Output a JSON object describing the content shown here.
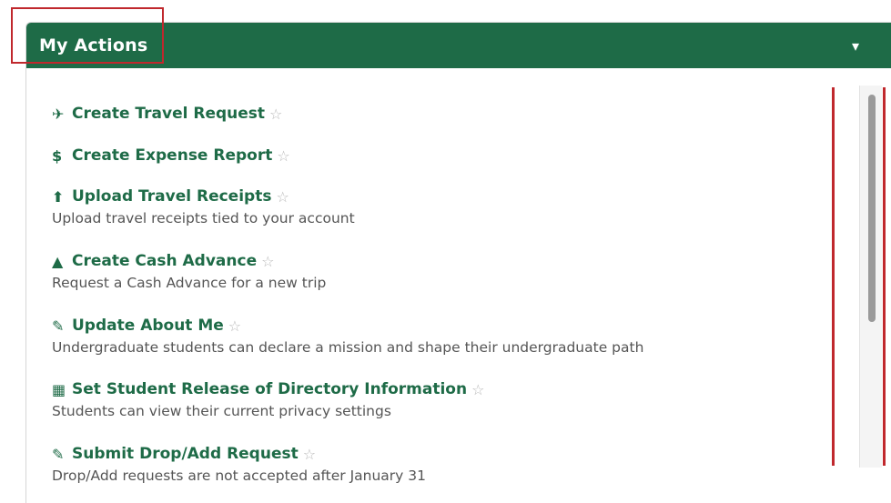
{
  "header": {
    "title": "My Actions",
    "collapse_icon": "chevron-down-icon"
  },
  "actions": [
    {
      "title": "Create Travel Request",
      "icon": "plane-icon",
      "glyph": "✈",
      "description": ""
    },
    {
      "title": "Create Expense Report",
      "icon": "dollar-icon",
      "glyph": "$",
      "description": ""
    },
    {
      "title": "Upload Travel Receipts",
      "icon": "upload-icon",
      "glyph": "⬆",
      "description": "Upload travel receipts tied to your account"
    },
    {
      "title": "Create Cash Advance",
      "icon": "warning-icon",
      "glyph": "▲",
      "description": "Request a Cash Advance for a new trip"
    },
    {
      "title": "Update About Me",
      "icon": "edit-icon",
      "glyph": "✎",
      "description": "Undergraduate students can declare a mission and shape their undergraduate path"
    },
    {
      "title": "Set Student Release of Directory Information",
      "icon": "building-icon",
      "glyph": "▦",
      "description": "Students can view their current privacy settings"
    },
    {
      "title": "Submit Drop/Add Request",
      "icon": "edit-icon",
      "glyph": "✎",
      "description": "Drop/Add requests are not accepted after January 31"
    }
  ],
  "colors": {
    "header_bg": "#1e6b47",
    "title_text": "#1e6b47",
    "highlight_border": "#c0282d",
    "star": "#b9b9b9"
  }
}
